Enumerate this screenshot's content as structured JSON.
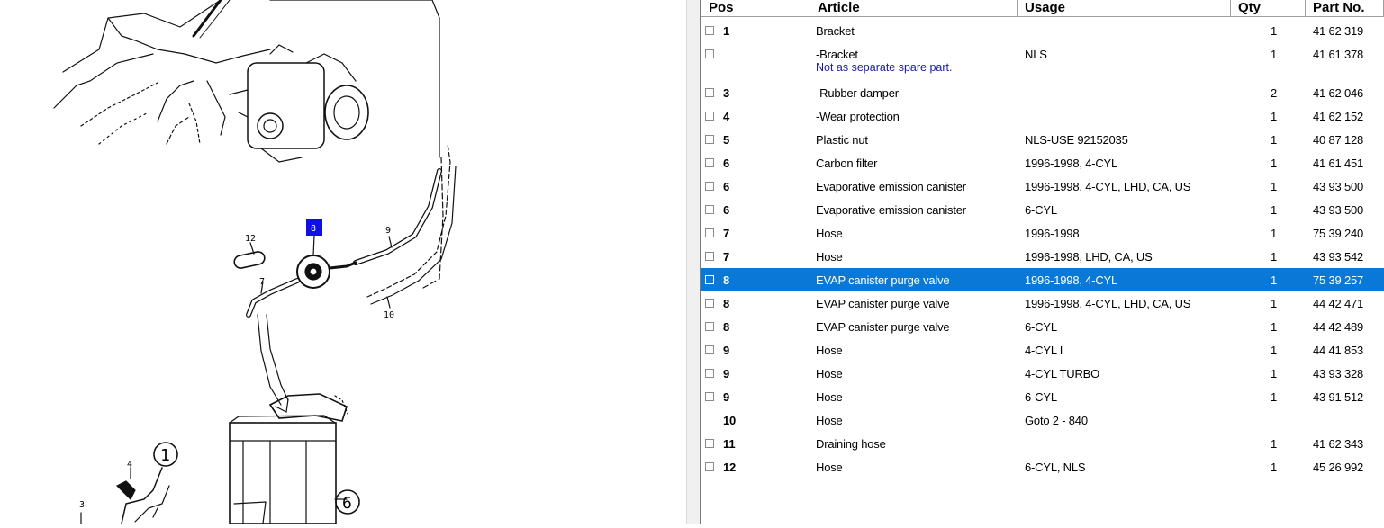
{
  "diagram": {
    "labels": {
      "l12": "12",
      "l8": "8",
      "l9": "9",
      "l7": "7",
      "l10": "10",
      "l4": "4",
      "l3": "3",
      "c1": "1",
      "c6": "6"
    },
    "highlight_color": "#1010e0"
  },
  "table": {
    "columns": {
      "pos": "Pos",
      "article": "Article",
      "usage": "Usage",
      "qty": "Qty",
      "partno": "Part No."
    },
    "selection_color": "#0a78d7",
    "rows": [
      {
        "pos": "1",
        "article": "Bracket",
        "usage": "",
        "qty": "1",
        "partno": "41 62 319"
      },
      {
        "pos": "",
        "article": "-Bracket",
        "usage": "NLS",
        "qty": "1",
        "partno": "41 61 378",
        "note": "Not as separate spare part."
      },
      {
        "pos": "3",
        "article": "-Rubber damper",
        "usage": "",
        "qty": "2",
        "partno": "41 62 046"
      },
      {
        "pos": "4",
        "article": "-Wear protection",
        "usage": "",
        "qty": "1",
        "partno": "41 62 152"
      },
      {
        "pos": "5",
        "article": "Plastic nut",
        "usage": "NLS-USE 92152035",
        "qty": "1",
        "partno": "40 87 128"
      },
      {
        "pos": "6",
        "article": "Carbon filter",
        "usage": "1996-1998, 4-CYL",
        "qty": "1",
        "partno": "41 61 451"
      },
      {
        "pos": "6",
        "article": "Evaporative emission canister",
        "usage": "1996-1998, 4-CYL, LHD, CA, US",
        "qty": "1",
        "partno": "43 93 500"
      },
      {
        "pos": "6",
        "article": "Evaporative emission canister",
        "usage": "6-CYL",
        "qty": "1",
        "partno": "43 93 500"
      },
      {
        "pos": "7",
        "article": "Hose",
        "usage": "1996-1998",
        "qty": "1",
        "partno": "75 39 240"
      },
      {
        "pos": "7",
        "article": "Hose",
        "usage": "1996-1998, LHD, CA, US",
        "qty": "1",
        "partno": "43 93 542"
      },
      {
        "pos": "8",
        "article": "EVAP canister purge valve",
        "usage": "1996-1998, 4-CYL",
        "qty": "1",
        "partno": "75 39 257",
        "selected": true
      },
      {
        "pos": "8",
        "article": "EVAP canister purge valve",
        "usage": "1996-1998, 4-CYL, LHD, CA, US",
        "qty": "1",
        "partno": "44 42 471"
      },
      {
        "pos": "8",
        "article": "EVAP canister purge valve",
        "usage": "6-CYL",
        "qty": "1",
        "partno": "44 42 489"
      },
      {
        "pos": "9",
        "article": "Hose",
        "usage": "4-CYL I",
        "qty": "1",
        "partno": "44 41 853"
      },
      {
        "pos": "9",
        "article": "Hose",
        "usage": "4-CYL TURBO",
        "qty": "1",
        "partno": "43 93 328"
      },
      {
        "pos": "9",
        "article": "Hose",
        "usage": "6-CYL",
        "qty": "1",
        "partno": "43 91 512"
      },
      {
        "pos": "10",
        "article": "Hose",
        "usage": "Goto 2 - 840",
        "qty": "",
        "partno": "",
        "no_checkbox": true
      },
      {
        "pos": "11",
        "article": "Draining hose",
        "usage": "",
        "qty": "1",
        "partno": "41 62 343"
      },
      {
        "pos": "12",
        "article": "Hose",
        "usage": "6-CYL, NLS",
        "qty": "1",
        "partno": "45 26 992"
      }
    ]
  }
}
